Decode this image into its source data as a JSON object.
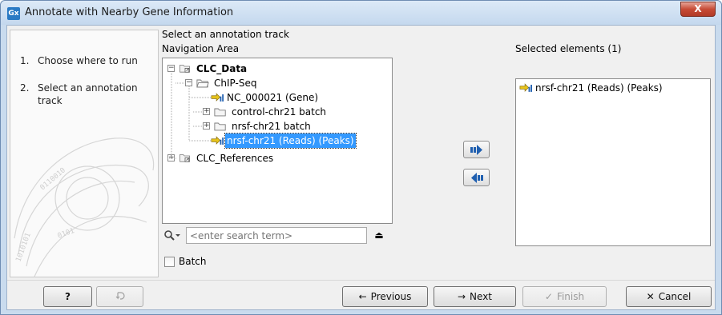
{
  "window": {
    "icon_text": "Gx",
    "title": "Annotate with Nearby Gene Information",
    "close_glyph": "X"
  },
  "wizard": {
    "steps": [
      {
        "number": "1.",
        "label": "Choose where to run"
      },
      {
        "number": "2.",
        "label": "Select an annotation track"
      }
    ]
  },
  "main": {
    "panel_title": "Select an annotation track",
    "navigation_label": "Navigation Area",
    "selected_label": "Selected elements (1)"
  },
  "tree": {
    "root": "CLC_Data",
    "chipseq": "ChIP-Seq",
    "gene_track": "NC_000021 (Gene)",
    "control_batch": "control-chr21 batch",
    "nrsf_batch": "nrsf-chr21 batch",
    "peaks_track": "nrsf-chr21 (Reads) (Peaks)",
    "references": "CLC_References"
  },
  "search": {
    "placeholder": "<enter search term>",
    "value": ""
  },
  "batch": {
    "label": "Batch",
    "checked": false
  },
  "selected_elements": [
    {
      "label": "nrsf-chr21 (Reads) (Peaks)"
    }
  ],
  "buttons": {
    "help": "?",
    "previous": "Previous",
    "next": "Next",
    "finish": "Finish",
    "cancel": "Cancel"
  },
  "colors": {
    "selection": "#3399ff",
    "title_bar": "#c9dbee",
    "close": "#c74b36",
    "arrow_blue": "#1f5fb0",
    "track_yellow": "#e8c41a"
  }
}
